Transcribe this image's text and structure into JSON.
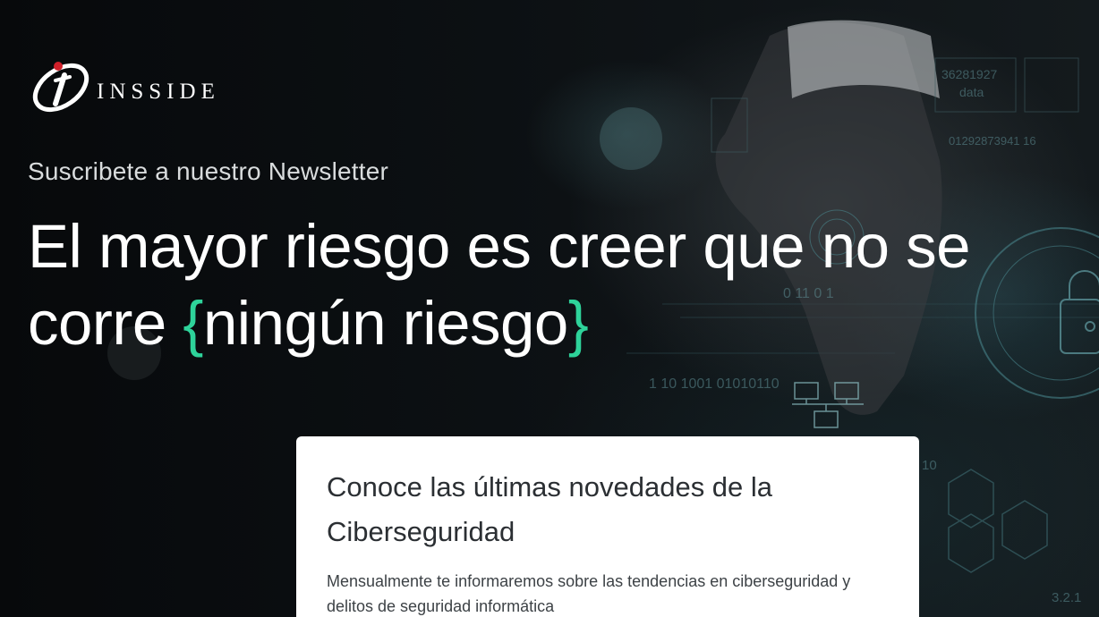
{
  "brand": {
    "logo_text": "INSSIDE"
  },
  "hero": {
    "subtitle": "Suscribete a nuestro Newsletter",
    "headline_part1": "El mayor riesgo es creer que no se",
    "headline_part2": "corre",
    "brace_open": "{",
    "highlight": "ningún riesgo",
    "brace_close": "}"
  },
  "card": {
    "title": "Conoce las últimas novedades de la Ciberseguridad",
    "description": "Mensualmente te informaremos sobre las tendencias en ciberseguridad y delitos de seguridad informática"
  },
  "background_overlay": {
    "digits_1": "0  11 0 1",
    "digits_2": "1 10  1001  01010110",
    "digits_3": "36281927",
    "digits_4": "data",
    "digits_5": "01292873941 16",
    "digits_6": "3.2.1",
    "digits_7": "10"
  },
  "colors": {
    "accent": "#2ed39a",
    "background": "#0b0f12",
    "card_bg": "#ffffff",
    "logo_dot": "#d0202a"
  }
}
